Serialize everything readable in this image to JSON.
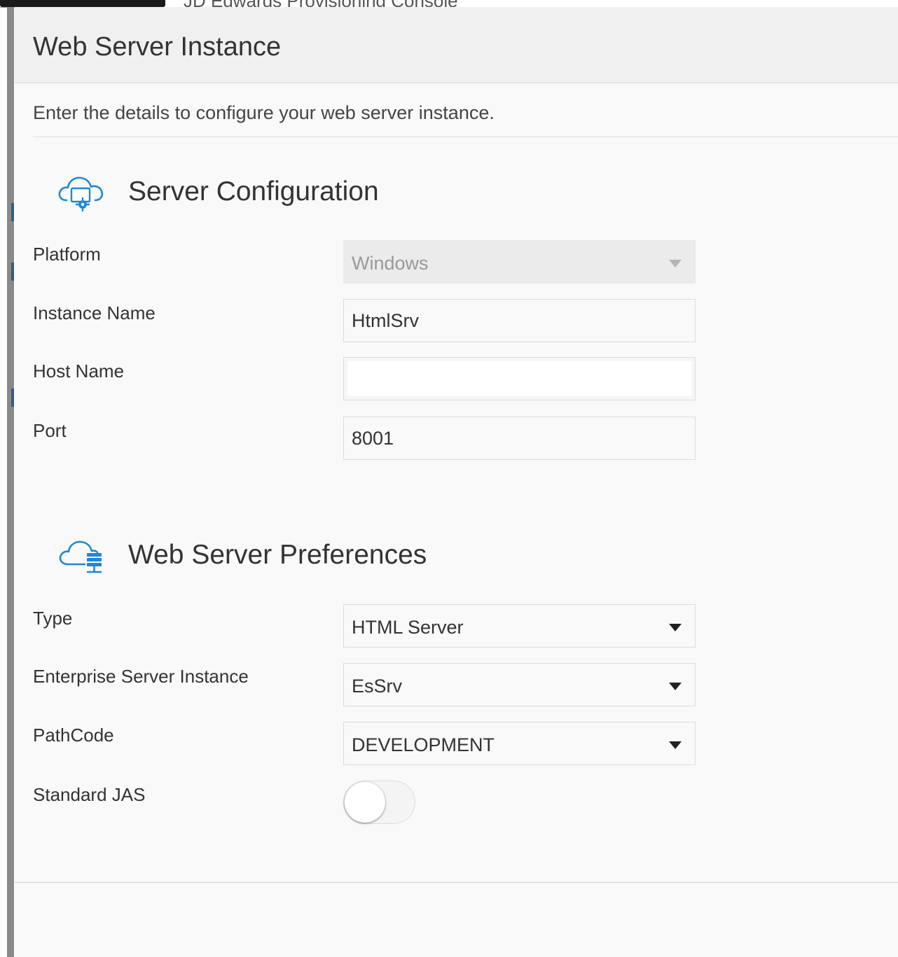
{
  "background": {
    "app_title": "JD Edwards Provisioning Console"
  },
  "dialog": {
    "title": "Web Server Instance",
    "intro": "Enter the details to configure your web server instance."
  },
  "server_configuration": {
    "title": "Server Configuration",
    "icon": "cloud-gear-icon",
    "platform": {
      "label": "Platform",
      "value": "Windows",
      "disabled": true
    },
    "instance_name": {
      "label": "Instance Name",
      "value": "HtmlSrv"
    },
    "host_name": {
      "label": "Host Name",
      "value": ""
    },
    "port": {
      "label": "Port",
      "value": "8001"
    }
  },
  "web_server_preferences": {
    "title": "Web Server Preferences",
    "icon": "cloud-server-icon",
    "type": {
      "label": "Type",
      "value": "HTML Server"
    },
    "enterprise_server_instance": {
      "label": "Enterprise Server Instance",
      "value": "EsSrv"
    },
    "pathcode": {
      "label": "PathCode",
      "value": "DEVELOPMENT"
    },
    "standard_jas": {
      "label": "Standard JAS",
      "on": false
    }
  },
  "colors": {
    "icon_blue": "#1e88d2",
    "dialog_bg": "#f9f9f9",
    "header_bg": "#f0f0f0"
  }
}
